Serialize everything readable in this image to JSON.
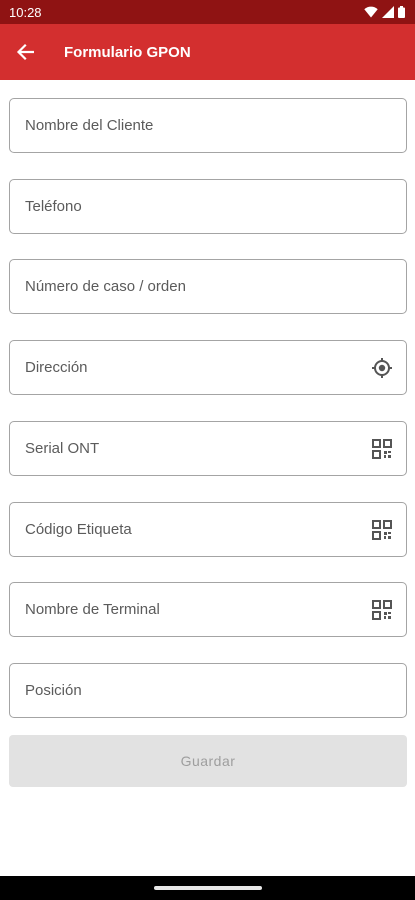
{
  "status_bar": {
    "time": "10:28",
    "icons": [
      "wifi-icon",
      "signal-icon",
      "battery-icon"
    ]
  },
  "app_bar": {
    "title": "Formulario GPON",
    "back_icon": "arrow-left-icon",
    "background": "#d32f2f",
    "status_background": "#8f1313"
  },
  "form": {
    "fields": [
      {
        "name": "nombre-cliente-field",
        "placeholder": "Nombre del Cliente",
        "value": "",
        "icon": null
      },
      {
        "name": "telefono-field",
        "placeholder": "Teléfono",
        "value": "",
        "icon": null
      },
      {
        "name": "numero-caso-field",
        "placeholder": "Número de caso / orden",
        "value": "",
        "icon": null
      },
      {
        "name": "direccion-field",
        "placeholder": "Dirección",
        "value": "",
        "icon": "gps-target-icon"
      },
      {
        "name": "serial-ont-field",
        "placeholder": "Serial ONT",
        "value": "",
        "icon": "qr-scan-icon"
      },
      {
        "name": "codigo-etiqueta-field",
        "placeholder": "Código Etiqueta",
        "value": "",
        "icon": "qr-scan-icon"
      },
      {
        "name": "nombre-terminal-field",
        "placeholder": "Nombre de Terminal",
        "value": "",
        "icon": "qr-scan-icon"
      },
      {
        "name": "posicion-field",
        "placeholder": "Posición",
        "value": "",
        "icon": null
      }
    ],
    "save_label": "Guardar",
    "save_enabled": false
  }
}
